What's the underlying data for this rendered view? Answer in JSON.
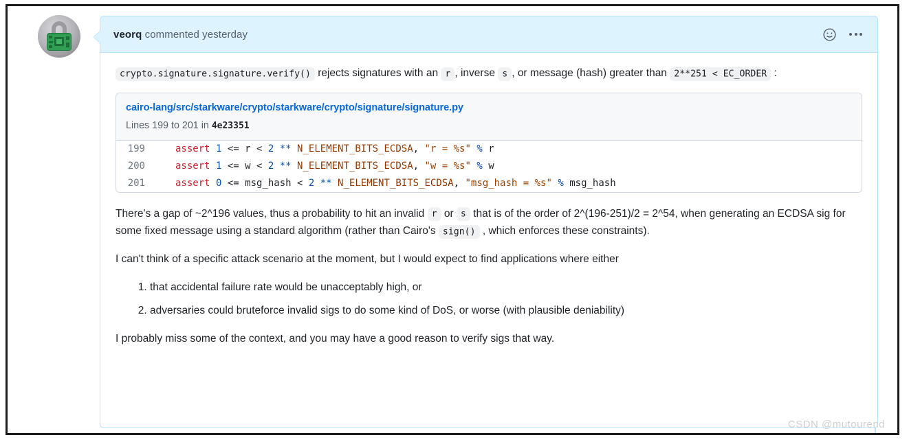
{
  "comment": {
    "avatar_alt": "veorq avatar padlock",
    "author": "veorq",
    "action_text": " commented yesterday",
    "icons": {
      "reaction": "smiley-face-icon",
      "menu": "kebab-menu-icon"
    }
  },
  "body": {
    "para1": {
      "code1": "crypto.signature.signature.verify()",
      "text1": " rejects signatures with an ",
      "code2": "r",
      "text2": ", inverse ",
      "code3": "s",
      "text3": ", or message (hash) greater than ",
      "code4": "2**251 < EC_ORDER",
      "text4": " :"
    },
    "snippet": {
      "path": "cairo-lang/src/starkware/crypto/starkware/crypto/signature/signature.py",
      "lines_prefix": "Lines 199 to 201 in ",
      "commit": "4e23351",
      "rows": [
        {
          "number": "199",
          "tokens": [
            {
              "t": "assert ",
              "c": "tok-kw"
            },
            {
              "t": "1",
              "c": "tok-num"
            },
            {
              "t": " <= r < ",
              "c": ""
            },
            {
              "t": "2",
              "c": "tok-num"
            },
            {
              "t": " ** ",
              "c": "tok-op"
            },
            {
              "t": "N_ELEMENT_BITS_ECDSA",
              "c": "tok-name"
            },
            {
              "t": ", ",
              "c": ""
            },
            {
              "t": "\"r = %s\"",
              "c": "tok-str"
            },
            {
              "t": " % ",
              "c": "tok-op"
            },
            {
              "t": "r",
              "c": ""
            }
          ]
        },
        {
          "number": "200",
          "tokens": [
            {
              "t": "assert ",
              "c": "tok-kw"
            },
            {
              "t": "1",
              "c": "tok-num"
            },
            {
              "t": " <= w < ",
              "c": ""
            },
            {
              "t": "2",
              "c": "tok-num"
            },
            {
              "t": " ** ",
              "c": "tok-op"
            },
            {
              "t": "N_ELEMENT_BITS_ECDSA",
              "c": "tok-name"
            },
            {
              "t": ", ",
              "c": ""
            },
            {
              "t": "\"w = %s\"",
              "c": "tok-str"
            },
            {
              "t": " % ",
              "c": "tok-op"
            },
            {
              "t": "w",
              "c": ""
            }
          ]
        },
        {
          "number": "201",
          "tokens": [
            {
              "t": "assert ",
              "c": "tok-kw"
            },
            {
              "t": "0",
              "c": "tok-num"
            },
            {
              "t": " <= msg_hash < ",
              "c": ""
            },
            {
              "t": "2",
              "c": "tok-num"
            },
            {
              "t": " ** ",
              "c": "tok-op"
            },
            {
              "t": "N_ELEMENT_BITS_ECDSA",
              "c": "tok-name"
            },
            {
              "t": ", ",
              "c": ""
            },
            {
              "t": "\"msg_hash = %s\"",
              "c": "tok-str"
            },
            {
              "t": " % ",
              "c": "tok-op"
            },
            {
              "t": "msg_hash",
              "c": ""
            }
          ]
        }
      ]
    },
    "para2": {
      "text1": "There's a gap of ~2^196 values, thus a probability to hit an invalid ",
      "code1": "r",
      "text2": " or ",
      "code2": "s",
      "text3": " that is of the order of 2^(196-251)/2 = 2^54, when generating an ECDSA sig for some fixed message using a standard algorithm (rather than Cairo's ",
      "code3": "sign()",
      "text4": " , which enforces these constraints)."
    },
    "para3": "I can't think of a specific attack scenario at the moment, but I would expect to find applications where either",
    "list": [
      "that accidental failure rate would be unacceptably high, or",
      "adversaries could bruteforce invalid sigs to do some kind of DoS, or worse (with plausible deniability)"
    ],
    "para4": "I probably miss some of the context, and you may have a good reason to verify sigs that way."
  },
  "watermark": "CSDN @mutourend",
  "colors": {
    "header_bg": "#ddf4ff",
    "header_border": "#b6e3ff",
    "link": "#0969da",
    "keyword": "#cf222e",
    "number": "#0550ae",
    "identifier": "#953800",
    "string": "#a04100",
    "text": "#1f2328",
    "muted": "#57606a"
  }
}
